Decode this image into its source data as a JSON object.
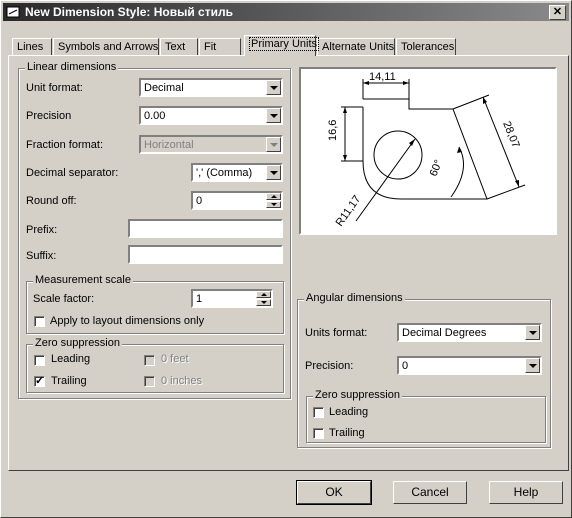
{
  "window": {
    "title": "New Dimension Style: Новый стиль",
    "close_symbol": "✕"
  },
  "tabs": [
    {
      "label": "Lines"
    },
    {
      "label": "Symbols and Arrows"
    },
    {
      "label": "Text"
    },
    {
      "label": "Fit"
    },
    {
      "label": "Primary Units",
      "active": true
    },
    {
      "label": "Alternate Units"
    },
    {
      "label": "Tolerances"
    }
  ],
  "linear": {
    "title": "Linear dimensions",
    "unit_format": {
      "label": "Unit format:",
      "value": "Decimal"
    },
    "precision": {
      "label": "Precision",
      "value": "0.00"
    },
    "fraction_format": {
      "label": "Fraction format:",
      "value": "Horizontal",
      "disabled": true
    },
    "decimal_separator": {
      "label": "Decimal separator:",
      "value": "',' (Comma)"
    },
    "round_off": {
      "label": "Round off:",
      "value": "0"
    },
    "prefix": {
      "label": "Prefix:",
      "value": ""
    },
    "suffix": {
      "label": "Suffix:",
      "value": ""
    },
    "measurement_scale": {
      "title": "Measurement scale",
      "scale_factor": {
        "label": "Scale factor:",
        "value": "1"
      },
      "apply_layout": {
        "label": "Apply to layout dimensions only",
        "checked": false
      }
    },
    "zero_suppression": {
      "title": "Zero suppression",
      "leading": {
        "label": "Leading",
        "checked": false
      },
      "trailing": {
        "label": "Trailing",
        "checked": true
      },
      "feet": {
        "label": "0 feet",
        "checked": false,
        "disabled": true
      },
      "inches": {
        "label": "0 inches",
        "checked": false,
        "disabled": true
      }
    }
  },
  "preview": {
    "dim_top": "14,11",
    "dim_left": "16,6",
    "dim_right": "28,07",
    "dim_angle": "60°",
    "dim_radius": "R11,17"
  },
  "angular": {
    "title": "Angular dimensions",
    "units_format": {
      "label": "Units format:",
      "value": "Decimal Degrees"
    },
    "precision": {
      "label": "Precision:",
      "value": "0"
    },
    "zero_suppression": {
      "title": "Zero suppression",
      "leading": {
        "label": "Leading",
        "checked": false
      },
      "trailing": {
        "label": "Trailing",
        "checked": false
      }
    }
  },
  "buttons": {
    "ok": "OK",
    "cancel": "Cancel",
    "help": "Help"
  },
  "check_mark": "✓"
}
